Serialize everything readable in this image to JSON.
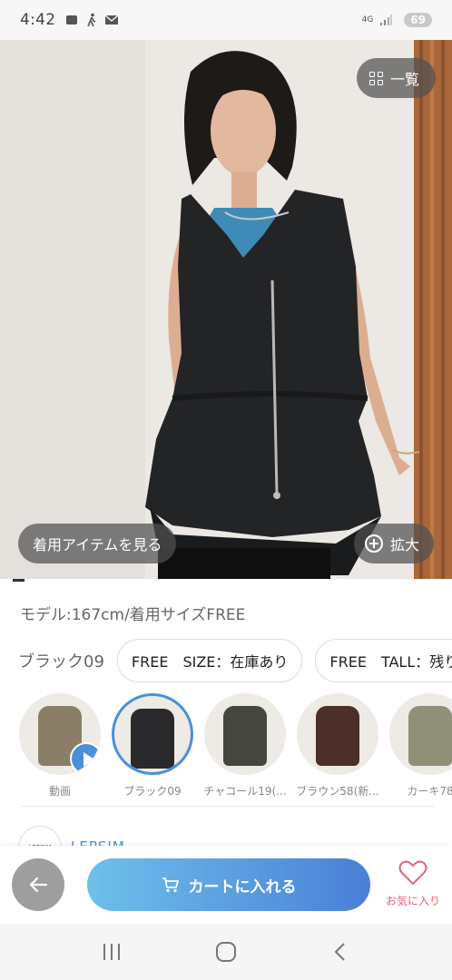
{
  "status_bar": {
    "time": "4:42",
    "network": "4G",
    "battery": "69"
  },
  "hero": {
    "list_label": "一覧",
    "view_items_label": "着用アイテムを見る",
    "zoom_label": "拡大"
  },
  "model_info": "モデル:167cm/着用サイズFREE",
  "color_selected": "ブラック09",
  "sizes": [
    {
      "label": "FREE　SIZE：在庫あり"
    },
    {
      "label": "FREE　TALL：残り"
    }
  ],
  "swatches": [
    {
      "caption": "動画",
      "color": "#8a7f66"
    },
    {
      "caption": "ブラック09",
      "color": "#2a2a2c"
    },
    {
      "caption": "チャコール19(...",
      "color": "#45473f"
    },
    {
      "caption": "ブラウン58(新...",
      "color": "#4b2f28"
    },
    {
      "caption": "カーキ78",
      "color": "#8e9077"
    }
  ],
  "brand": {
    "logo_text": "LEPSIM",
    "name": "LEPSIM"
  },
  "actions": {
    "cart_label": "カートに入れる",
    "favorite_label": "お気に入り"
  }
}
